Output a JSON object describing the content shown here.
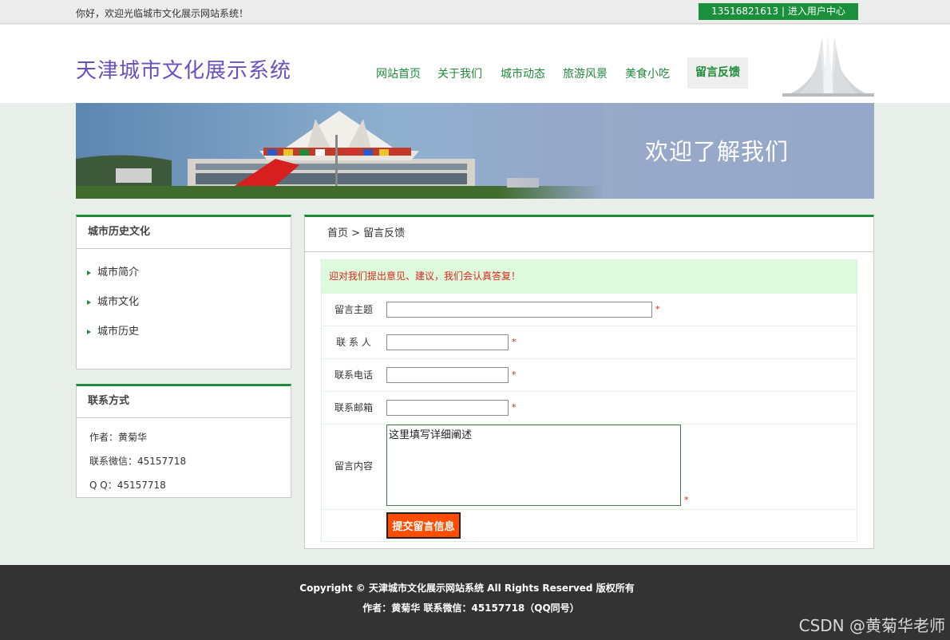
{
  "topbar": {
    "greeting": "你好，欢迎光临城市文化展示网站系统！",
    "user_center": "13516821613  | 进入用户中心"
  },
  "header": {
    "site_title": "天津城市文化展示系统",
    "nav": [
      {
        "label": "网站首页"
      },
      {
        "label": "关于我们"
      },
      {
        "label": "城市动态"
      },
      {
        "label": "旅游风景"
      },
      {
        "label": "美食小吃"
      },
      {
        "label": "留言反馈",
        "active": true
      }
    ]
  },
  "banner": {
    "text": "欢迎了解我们"
  },
  "sidebar": {
    "history": {
      "title": "城市历史文化",
      "items": [
        {
          "label": "城市简介"
        },
        {
          "label": "城市文化"
        },
        {
          "label": "城市历史"
        }
      ]
    },
    "contact": {
      "title": "联系方式",
      "lines": [
        "作者：黄菊华",
        "联系微信：45157718",
        "Q Q：45157718"
      ]
    }
  },
  "main": {
    "breadcrumb": "首页 > 留言反馈",
    "notice": "迎对我们提出意见、建议，我们会认真答复！",
    "form": {
      "subject_label": "留言主题",
      "subject_value": "",
      "contact_label": "联 系 人",
      "contact_value": "",
      "phone_label": "联系电话",
      "phone_value": "",
      "email_label": "联系邮箱",
      "email_value": "",
      "content_label": "留言内容",
      "content_value": "这里填写详细阐述",
      "required_mark": "*",
      "submit_label": "提交留言信息"
    }
  },
  "footer": {
    "copyright": "Copyright © 天津城市文化展示网站系统     All Rights Reserved 版权所有",
    "author": "作者：黄菊华     联系微信：45157718（QQ同号）",
    "watermark": "CSDN @黄菊华老师"
  },
  "colors": {
    "accent_green": "#1e8a3a",
    "title_purple": "#6a4fbf",
    "submit_orange": "#ff4d00",
    "notice_bg": "#defadd",
    "footer_bg": "#333333"
  }
}
